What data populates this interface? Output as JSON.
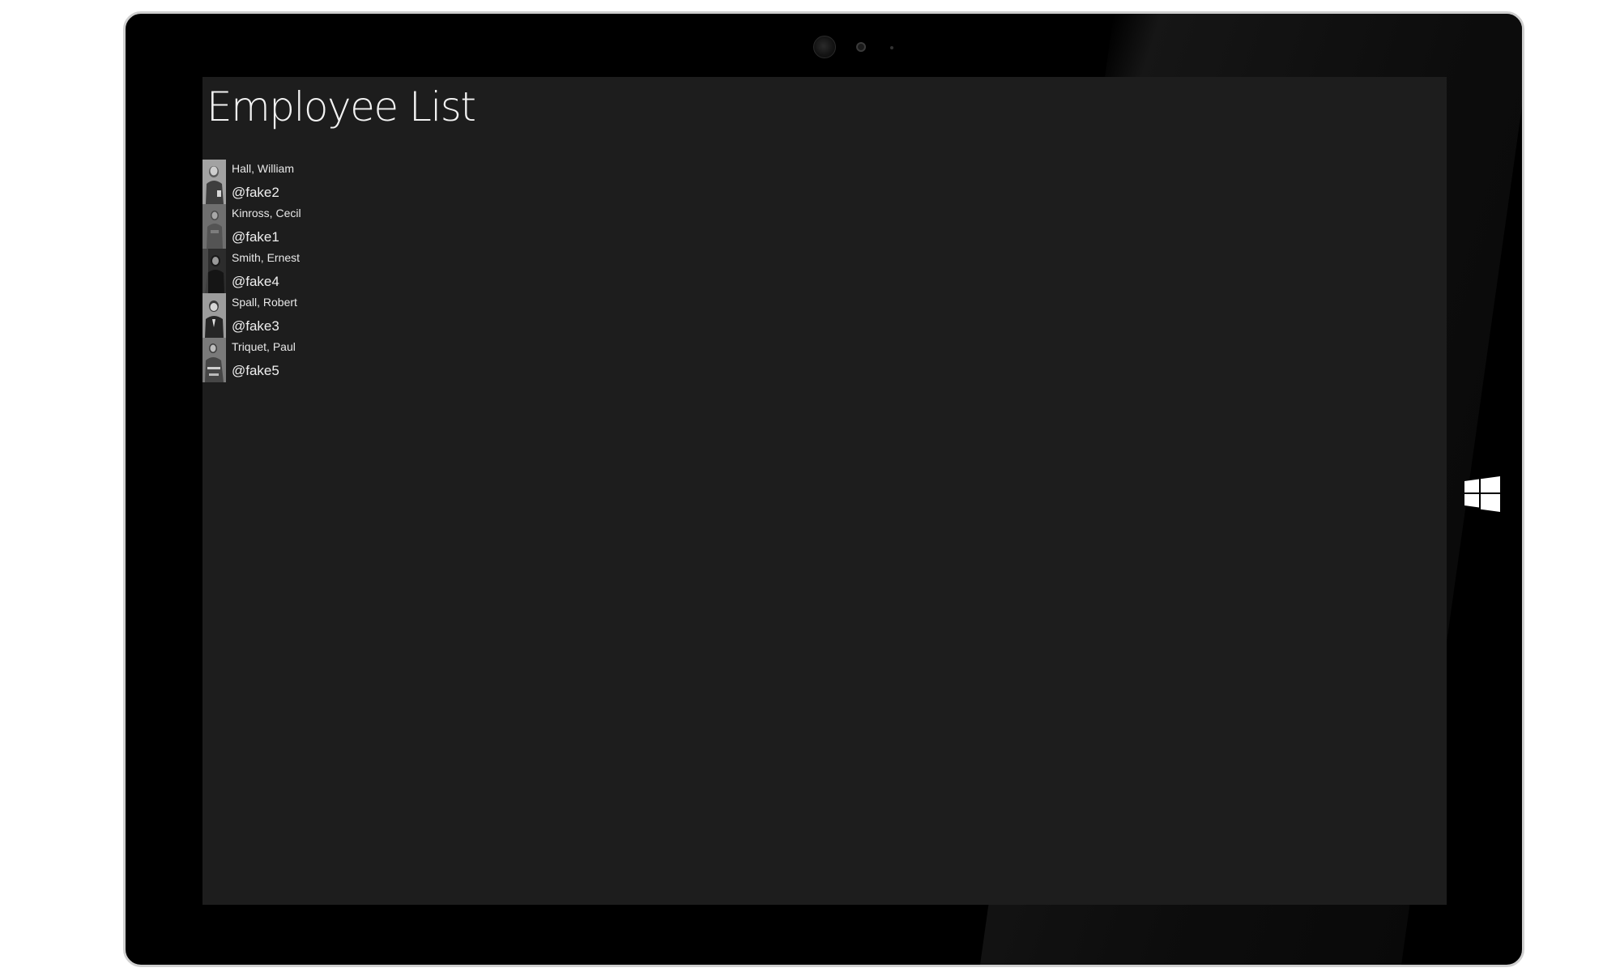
{
  "app": {
    "title": "Employee List"
  },
  "employees": [
    {
      "name": "Hall, William",
      "handle": "@fake2",
      "avatar_icon": "portrait-photo"
    },
    {
      "name": "Kinross, Cecil",
      "handle": "@fake1",
      "avatar_icon": "portrait-photo"
    },
    {
      "name": "Smith, Ernest",
      "handle": "@fake4",
      "avatar_icon": "portrait-photo"
    },
    {
      "name": "Spall, Robert",
      "handle": "@fake3",
      "avatar_icon": "portrait-photo"
    },
    {
      "name": "Triquet, Paul",
      "handle": "@fake5",
      "avatar_icon": "portrait-photo"
    }
  ],
  "device": {
    "home_button_icon": "windows-logo-icon"
  },
  "colors": {
    "screen_background": "#1d1d1d",
    "bezel": "#000000",
    "text": "#f2f2f2"
  }
}
